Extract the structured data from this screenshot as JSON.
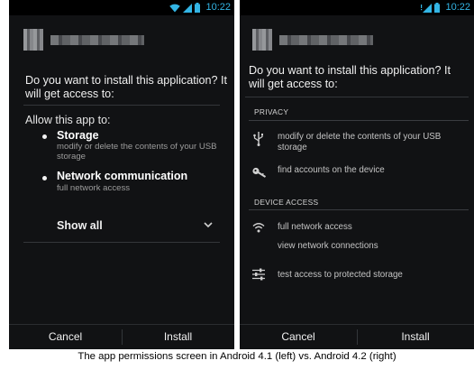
{
  "status": {
    "time": "10:22"
  },
  "left": {
    "question": "Do you want to install this application? It will get access to:",
    "allow_label": "Allow this app to:",
    "permissions": [
      {
        "title": "Storage",
        "desc": "modify or delete the contents of your USB storage"
      },
      {
        "title": "Network communication",
        "desc": "full network access"
      }
    ],
    "show_all": "Show all",
    "cancel": "Cancel",
    "install": "Install"
  },
  "right": {
    "question": "Do you want to install this application? It will get access to:",
    "sections": [
      {
        "header": "PRIVACY",
        "items": [
          {
            "icon": "usb-icon",
            "text": "modify or delete the contents of your USB storage"
          },
          {
            "icon": "key-icon",
            "text": "find accounts on the device"
          }
        ]
      },
      {
        "header": "DEVICE ACCESS",
        "items": [
          {
            "icon": "wifi-icon",
            "text": "full network access"
          },
          {
            "icon": "",
            "text": "view network connections"
          },
          {
            "icon": "settings-sliders-icon",
            "text": "test access to protected storage"
          }
        ]
      }
    ],
    "cancel": "Cancel",
    "install": "Install"
  },
  "caption": "The app permissions screen in Android 4.1 (left) vs. Android 4.2 (right)",
  "colors": {
    "accent": "#33b5e5",
    "background": "#111214",
    "divider": "#34363a"
  }
}
